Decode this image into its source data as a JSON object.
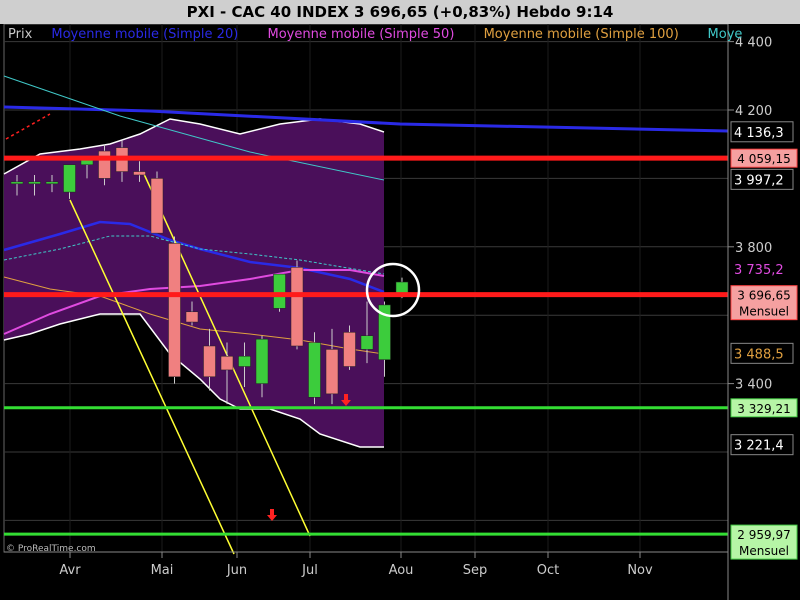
{
  "header": {
    "title": "PXI - CAC 40 INDEX     3 696,65 (+0,83%)     Hebdo  9:14"
  },
  "legend": {
    "items": [
      {
        "label": "Prix",
        "color": "#c8c8c8"
      },
      {
        "label": "Moyenne mobile (Simple 20)",
        "color": "#2a2ae6"
      },
      {
        "label": "Moyenne mobile (Simple 50)",
        "color": "#e04be0"
      },
      {
        "label": "Moyenne mobile (Simple 100)",
        "color": "#e0a040"
      },
      {
        "label": "Moye",
        "color": "#40c8c8"
      }
    ]
  },
  "watermark": "© ProRealTime.com",
  "chart_data": {
    "type": "candlestick",
    "y_ticks": [
      "4 400",
      "4 200",
      "3 800",
      "3 400"
    ],
    "x_ticks": [
      "Avr",
      "Mai",
      "Jun",
      "Jul",
      "Aou",
      "Sep",
      "Oct",
      "Nov"
    ],
    "candles": [
      {
        "o": 3990,
        "h": 4010,
        "l": 3950,
        "c": 3990
      },
      {
        "o": 3990,
        "h": 4010,
        "l": 3950,
        "c": 3990
      },
      {
        "o": 3990,
        "h": 4010,
        "l": 3960,
        "c": 3990
      },
      {
        "o": 3960,
        "h": 4040,
        "l": 3940,
        "c": 4040
      },
      {
        "o": 4040,
        "h": 4060,
        "l": 4000,
        "c": 4060
      },
      {
        "o": 4080,
        "h": 4100,
        "l": 3980,
        "c": 4000
      },
      {
        "o": 4090,
        "h": 4110,
        "l": 3990,
        "c": 4020
      },
      {
        "o": 4020,
        "h": 4050,
        "l": 3990,
        "c": 4010
      },
      {
        "o": 4000,
        "h": 4020,
        "l": 3840,
        "c": 3840
      },
      {
        "o": 3810,
        "h": 3830,
        "l": 3400,
        "c": 3420
      },
      {
        "o": 3610,
        "h": 3640,
        "l": 3570,
        "c": 3580
      },
      {
        "o": 3510,
        "h": 3560,
        "l": 3380,
        "c": 3420
      },
      {
        "o": 3480,
        "h": 3520,
        "l": 3340,
        "c": 3440
      },
      {
        "o": 3450,
        "h": 3520,
        "l": 3390,
        "c": 3480
      },
      {
        "o": 3400,
        "h": 3540,
        "l": 3360,
        "c": 3530
      },
      {
        "o": 3620,
        "h": 3720,
        "l": 3610,
        "c": 3720
      },
      {
        "o": 3740,
        "h": 3760,
        "l": 3500,
        "c": 3510
      },
      {
        "o": 3360,
        "h": 3550,
        "l": 3340,
        "c": 3520
      },
      {
        "o": 3500,
        "h": 3560,
        "l": 3340,
        "c": 3370
      },
      {
        "o": 3550,
        "h": 3570,
        "l": 3440,
        "c": 3450
      },
      {
        "o": 3500,
        "h": 3640,
        "l": 3460,
        "c": 3540
      },
      {
        "o": 3470,
        "h": 3640,
        "l": 3420,
        "c": 3630
      },
      {
        "o": 3660,
        "h": 3710,
        "l": 3650,
        "c": 3697
      }
    ],
    "horizontal_levels": [
      {
        "value": 4059.15,
        "label": "4 059,15",
        "color": "#ff1a1a",
        "sub": ""
      },
      {
        "value": 3660,
        "label": "3 696,65",
        "color": "#ff1a1a",
        "sub": "Mensuel"
      },
      {
        "value": 3329.21,
        "label": "3 329,21",
        "color": "#33dd33",
        "sub": ""
      },
      {
        "value": 2959.97,
        "label": "2 959,97",
        "color": "#33dd33",
        "sub": "Mensuel"
      }
    ],
    "axis_labels": [
      {
        "value": 4136.3,
        "text": "4 136,3",
        "bg": "#000000",
        "fg": "#ffffff",
        "border": "#888888"
      },
      {
        "value": 3997.2,
        "text": "3 997,2",
        "bg": "#000000",
        "fg": "#ffffff",
        "border": "#888888"
      },
      {
        "value": 3735.2,
        "text": "3 735,2",
        "bg": "#000000",
        "fg": "#e04be0",
        "border": "#000000"
      },
      {
        "value": 3488.5,
        "text": "3 488,5",
        "bg": "#000000",
        "fg": "#e0a040",
        "border": "#888888"
      },
      {
        "value": 3221.4,
        "text": "3 221,4",
        "bg": "#000000",
        "fg": "#ffffff",
        "border": "#888888"
      }
    ],
    "colors": {
      "up": "#3ccc3c",
      "down": "#f08080",
      "bollinger_fill": "#4a0f5a",
      "ma20": "#2a2ae6",
      "ma50": "#e04be0",
      "ma100": "#e0a040",
      "extra_ma": "#40c8c8",
      "trend": "#ffff33"
    }
  }
}
